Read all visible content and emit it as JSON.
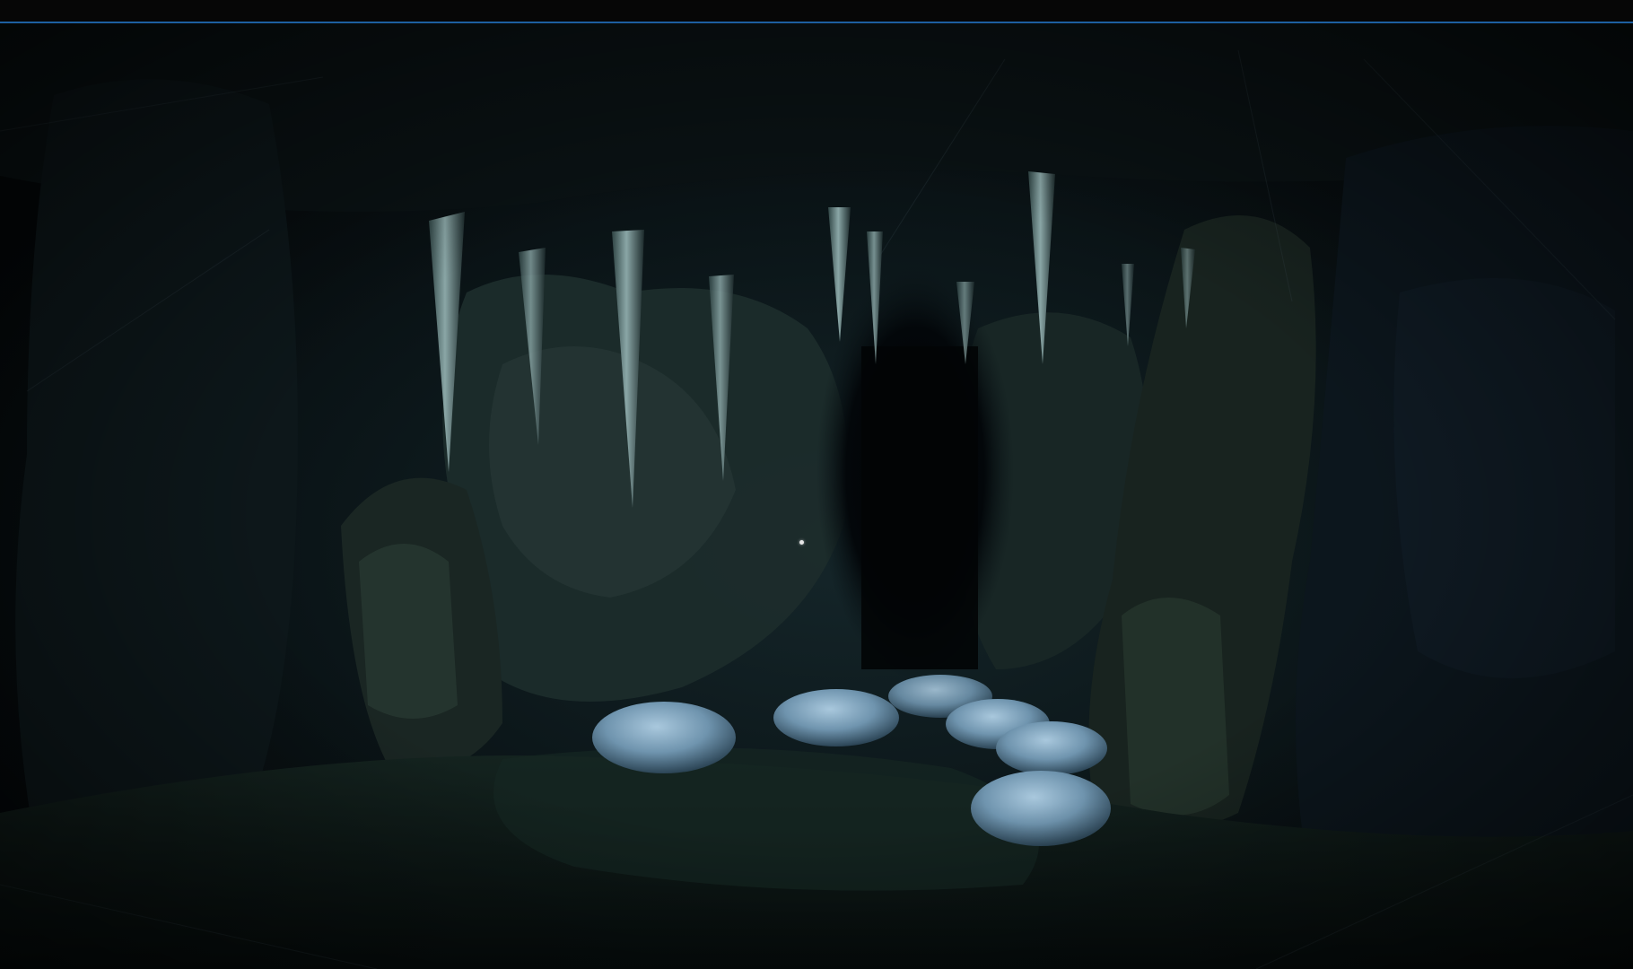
{
  "window": {
    "accent_color": "#1d5fa0"
  },
  "scene": {
    "setting": "cave",
    "colors": {
      "rock_dark": "#0b1418",
      "rock_mid": "#1a2a2c",
      "stalactite": "#7f9a9a",
      "ice_mound": "#7fa4bf",
      "void": "#020304"
    }
  },
  "hud": {
    "crosshair_icon": "crosshair-dot-icon"
  }
}
